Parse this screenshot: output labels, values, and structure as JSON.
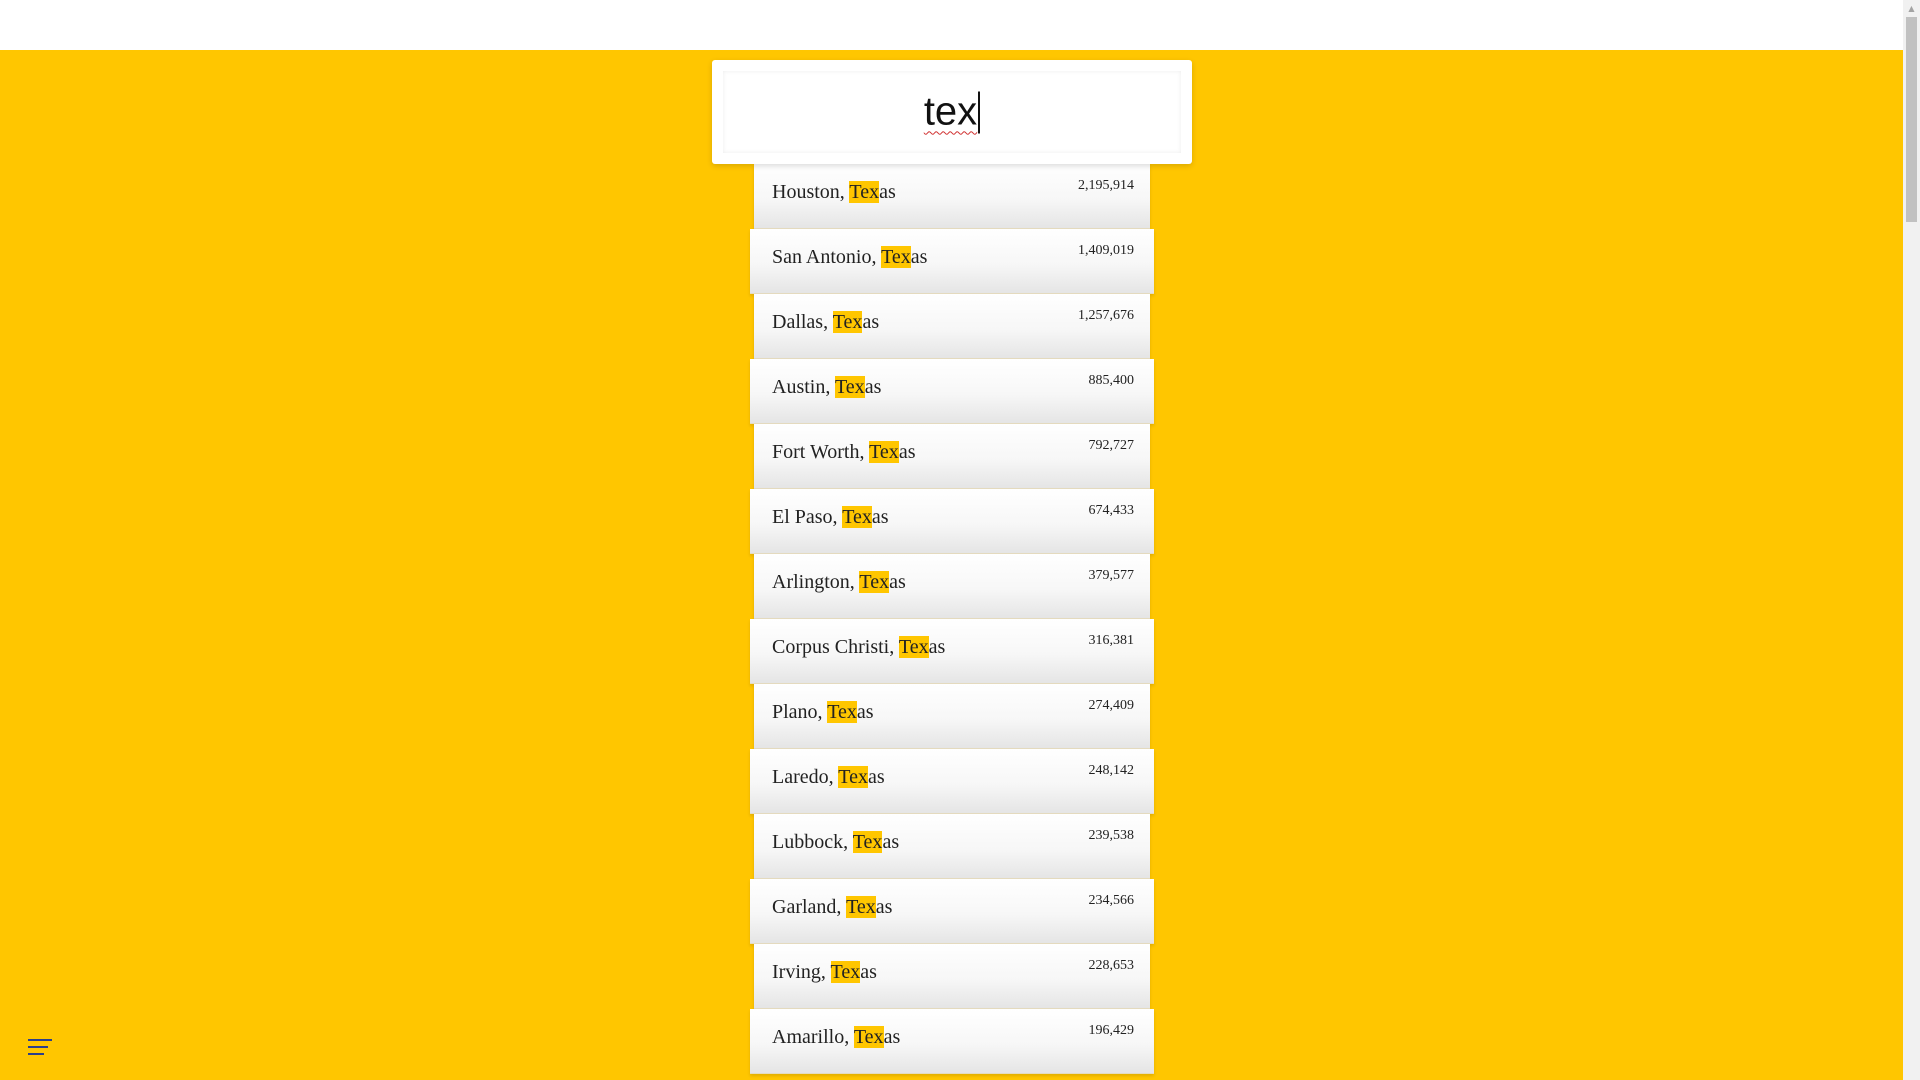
{
  "search": {
    "value": "tex",
    "highlight_color": "#ffc600"
  },
  "colors": {
    "background": "#ffc600",
    "accent": "#ffc600"
  },
  "suggestions": [
    {
      "prefix": "Houston, ",
      "match": "Tex",
      "suffix": "as",
      "population": "2,195,914"
    },
    {
      "prefix": "San Antonio, ",
      "match": "Tex",
      "suffix": "as",
      "population": "1,409,019"
    },
    {
      "prefix": "Dallas, ",
      "match": "Tex",
      "suffix": "as",
      "population": "1,257,676"
    },
    {
      "prefix": "Austin, ",
      "match": "Tex",
      "suffix": "as",
      "population": "885,400"
    },
    {
      "prefix": "Fort Worth, ",
      "match": "Tex",
      "suffix": "as",
      "population": "792,727"
    },
    {
      "prefix": "El Paso, ",
      "match": "Tex",
      "suffix": "as",
      "population": "674,433"
    },
    {
      "prefix": "Arlington, ",
      "match": "Tex",
      "suffix": "as",
      "population": "379,577"
    },
    {
      "prefix": "Corpus Christi, ",
      "match": "Tex",
      "suffix": "as",
      "population": "316,381"
    },
    {
      "prefix": "Plano, ",
      "match": "Tex",
      "suffix": "as",
      "population": "274,409"
    },
    {
      "prefix": "Laredo, ",
      "match": "Tex",
      "suffix": "as",
      "population": "248,142"
    },
    {
      "prefix": "Lubbock, ",
      "match": "Tex",
      "suffix": "as",
      "population": "239,538"
    },
    {
      "prefix": "Garland, ",
      "match": "Tex",
      "suffix": "as",
      "population": "234,566"
    },
    {
      "prefix": "Irving, ",
      "match": "Tex",
      "suffix": "as",
      "population": "228,653"
    },
    {
      "prefix": "Amarillo, ",
      "match": "Tex",
      "suffix": "as",
      "population": "196,429"
    }
  ],
  "icons": {
    "menu": "hamburger-menu-icon",
    "scroll_up": "scroll-up-arrow-icon"
  }
}
